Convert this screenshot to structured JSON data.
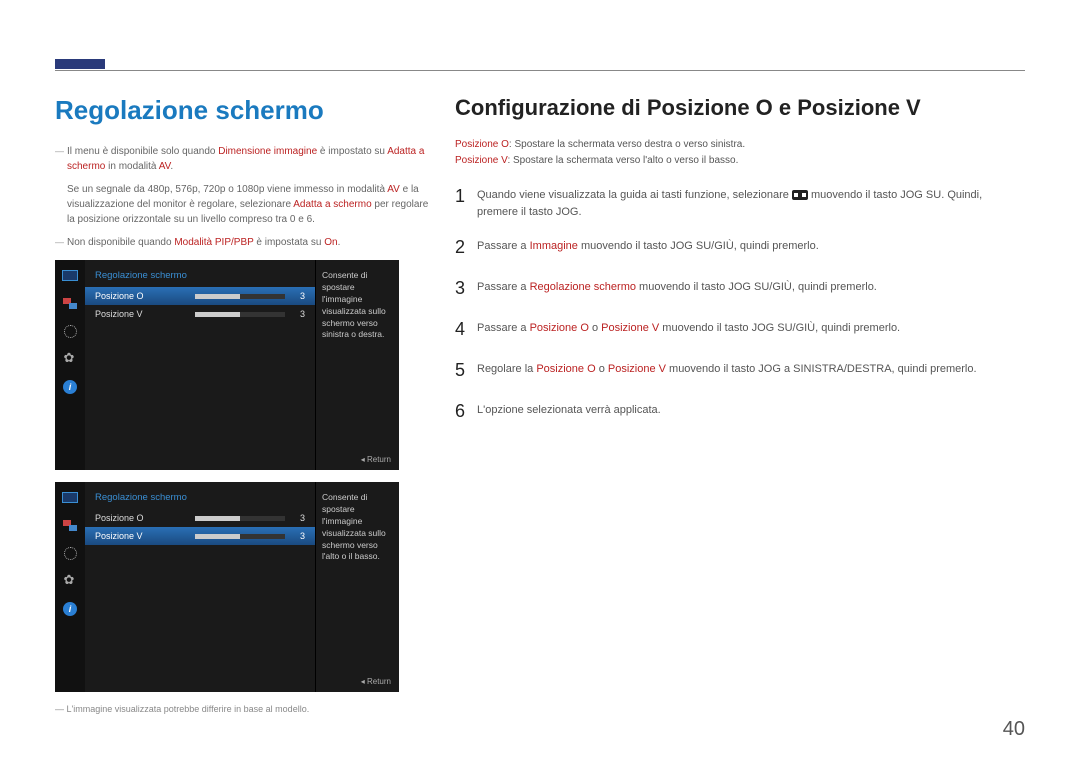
{
  "pageNumber": "40",
  "left": {
    "heading": "Regolazione schermo",
    "notes": [
      {
        "pre": "Il menu è disponibile solo quando ",
        "b1": "Dimensione immagine",
        "mid": " è impostato su ",
        "b2": "Adatta a schermo",
        "post": " in modalità ",
        "b3": "AV",
        "end": "."
      },
      {
        "pre": "Se un segnale da 480p, 576p, 720p o 1080p viene immesso in modalità ",
        "b1": "AV",
        "mid": " e la visualizzazione del monitor è regolare, selezionare ",
        "b2": "Adatta a schermo",
        "post": " per regolare la posizione orizzontale su un livello compreso tra 0 e 6."
      },
      {
        "pre": "Non disponibile quando ",
        "b1": "Modalità PIP/PBP",
        "mid": " è impostata su ",
        "b2": "On",
        "end": "."
      }
    ],
    "osd": {
      "title": "Regolazione schermo",
      "item1": {
        "label": "Posizione O",
        "val": "3"
      },
      "item2": {
        "label": "Posizione V",
        "val": "3"
      },
      "desc1": "Consente di spostare l'immagine visualizzata sullo schermo verso sinistra o destra.",
      "desc2": "Consente di spostare l'immagine visualizzata sullo schermo verso l'alto o il basso.",
      "return": "Return",
      "info": "i"
    },
    "footnote": "L'immagine visualizzata potrebbe differire in base al modello."
  },
  "right": {
    "heading": "Configurazione di Posizione O e Posizione V",
    "defO": {
      "label": "Posizione O",
      "text": ": Spostare la schermata verso destra o verso sinistra."
    },
    "defV": {
      "label": "Posizione V",
      "text": ": Spostare la schermata verso l'alto o verso il basso."
    },
    "steps": [
      {
        "n": "1",
        "pre": "Quando viene visualizzata la guida ai tasti funzione, selezionare ",
        "icon": true,
        "post": " muovendo il tasto JOG SU. Quindi, premere il tasto JOG."
      },
      {
        "n": "2",
        "pre": "Passare a ",
        "b1": "Immagine",
        "post": " muovendo il tasto JOG SU/GIÙ, quindi premerlo."
      },
      {
        "n": "3",
        "pre": "Passare a ",
        "b1": "Regolazione schermo",
        "post": " muovendo il tasto JOG SU/GIÙ, quindi premerlo."
      },
      {
        "n": "4",
        "pre": "Passare a ",
        "b1": "Posizione O",
        "mid": " o ",
        "b2": "Posizione V",
        "post": " muovendo il tasto JOG SU/GIÙ, quindi premerlo."
      },
      {
        "n": "5",
        "pre": "Regolare la ",
        "b1": "Posizione O",
        "mid": " o ",
        "b2": "Posizione V",
        "post": " muovendo il tasto JOG a SINISTRA/DESTRA, quindi premerlo."
      },
      {
        "n": "6",
        "pre": "L'opzione selezionata verrà applicata."
      }
    ]
  }
}
